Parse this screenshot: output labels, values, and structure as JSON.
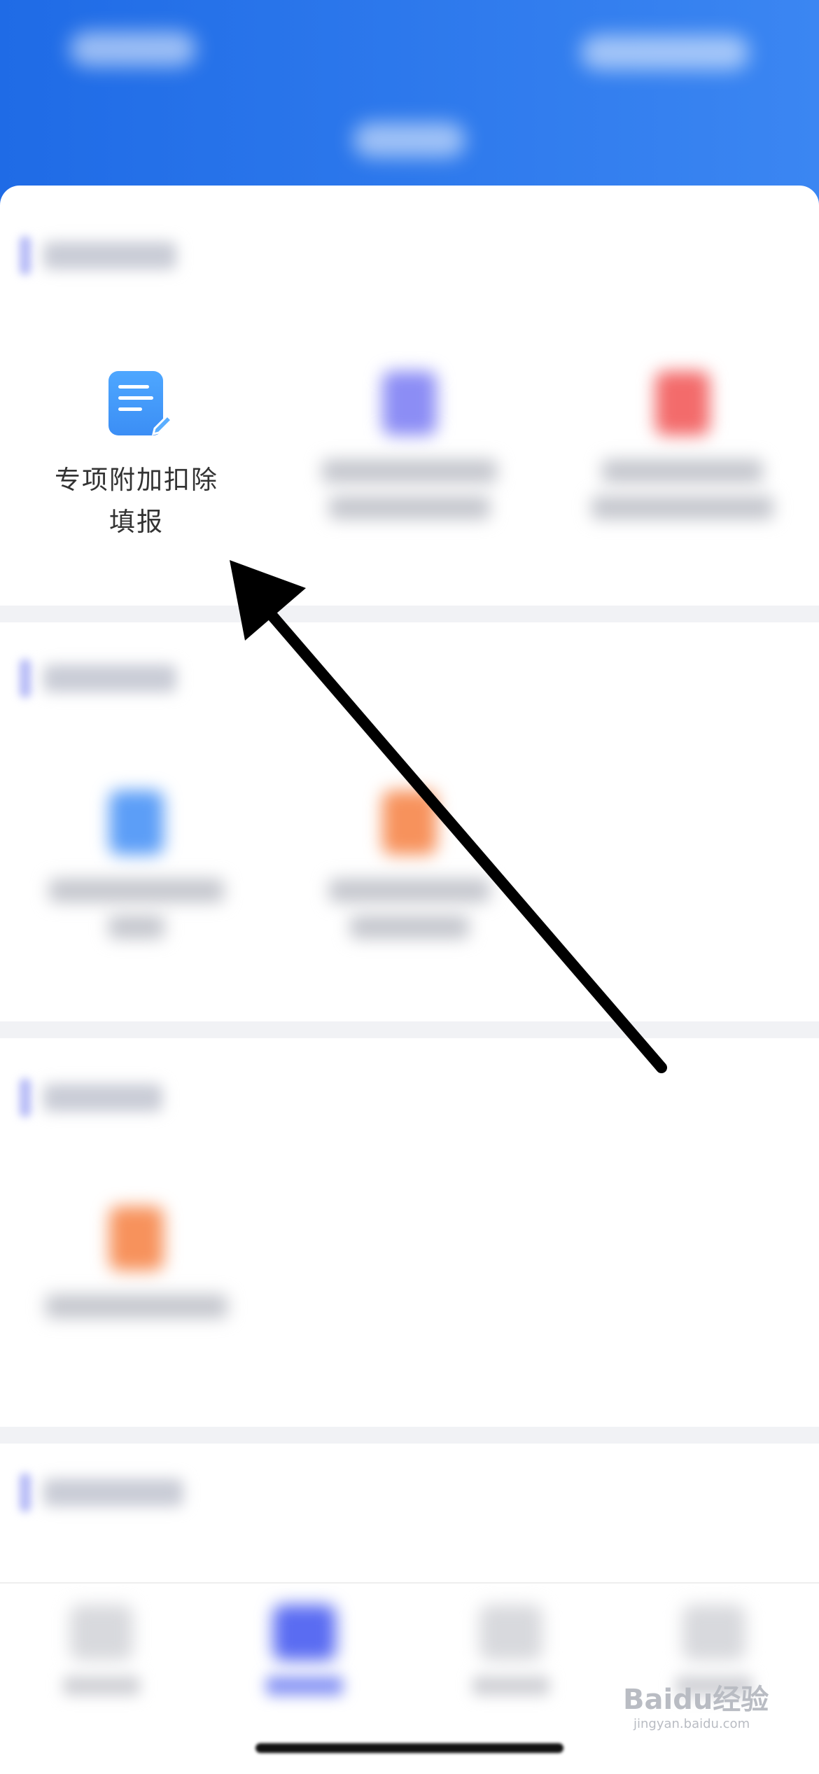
{
  "main": {
    "featured_item": {
      "label_line1": "专项附加扣除",
      "label_line2": "填报",
      "icon": "edit-document-icon",
      "icon_color": "#3b8ef5"
    }
  },
  "watermark": {
    "brand": "Baidu经验",
    "url": "jingyan.baidu.com"
  },
  "colors": {
    "header_gradient_start": "#1f6be6",
    "header_gradient_end": "#3b86f2",
    "arrow": "#000000"
  }
}
